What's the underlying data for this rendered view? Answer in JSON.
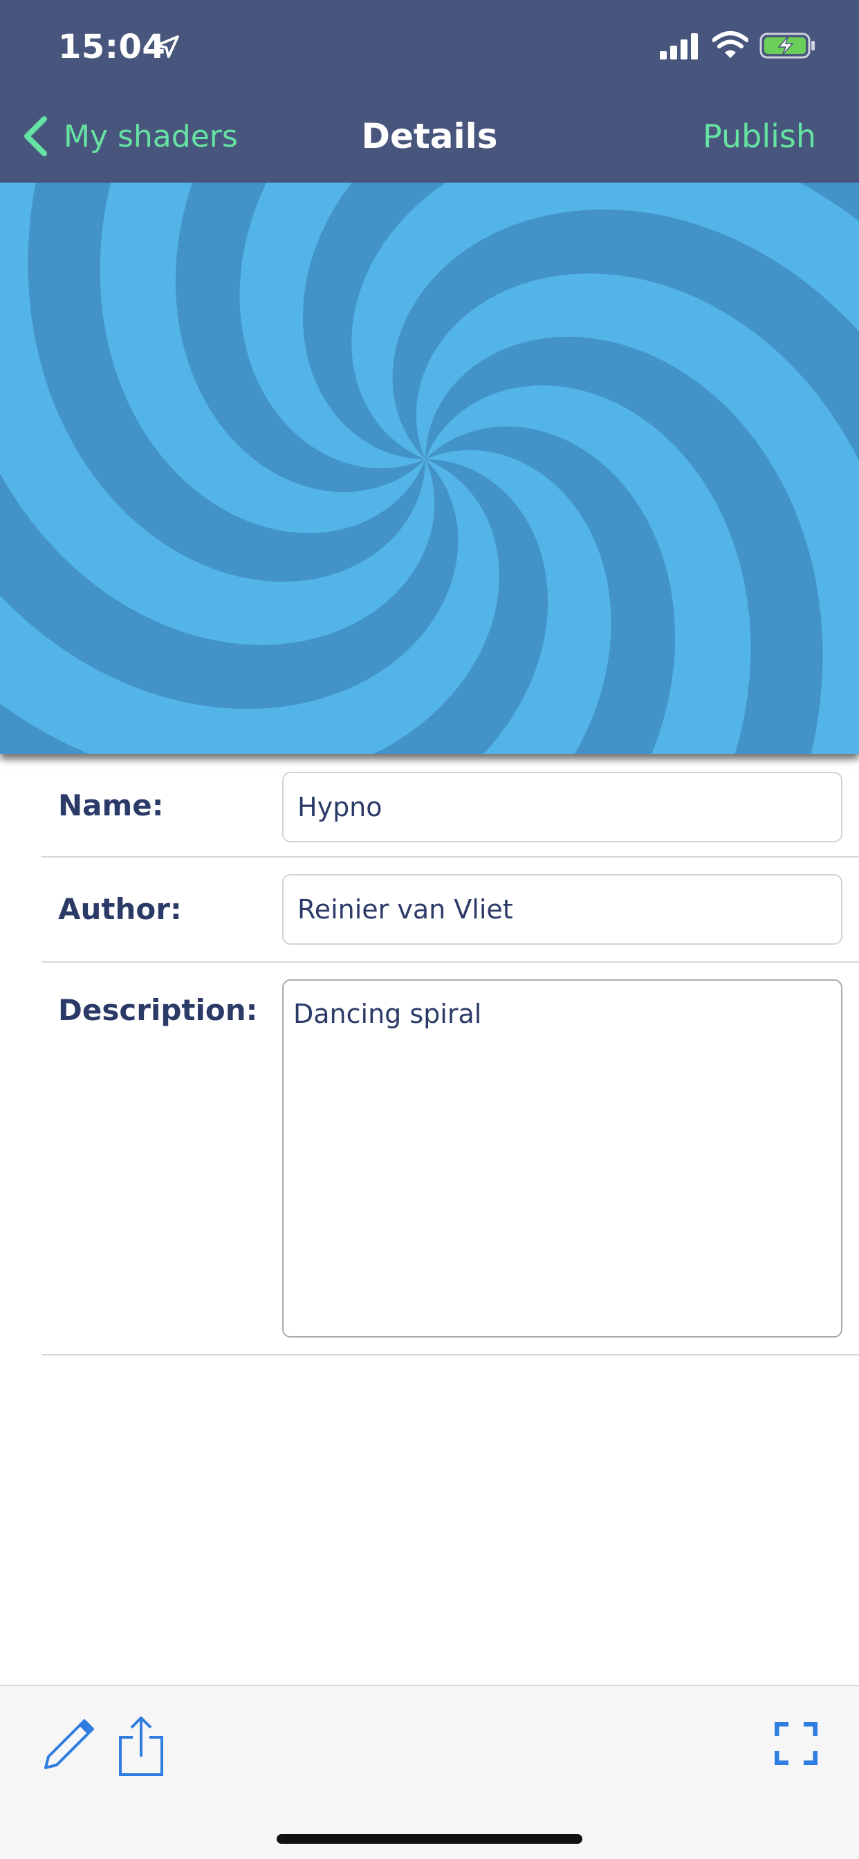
{
  "status_bar": {
    "time": "15:04",
    "icons": [
      "location-arrow-icon",
      "cellular-signal-icon",
      "wifi-icon",
      "battery-charging-icon"
    ]
  },
  "nav": {
    "back_label": "My shaders",
    "title": "Details",
    "publish_label": "Publish"
  },
  "preview": {
    "description": "swirl shader preview",
    "colors": {
      "light": "#53b4e7",
      "dark": "#4493c8"
    }
  },
  "form": {
    "name_label": "Name:",
    "name_value": "Hypno",
    "author_label": "Author:",
    "author_value": "Reinier van Vliet",
    "description_label": "Description:",
    "description_value": "Dancing spiral"
  },
  "toolbar": {
    "icons": [
      "pencil-icon",
      "share-icon",
      "fullscreen-icon"
    ]
  },
  "colors": {
    "header_bg": "#48567d",
    "accent_green": "#66e3a2",
    "label_text": "#2b3a67",
    "toolbar_icon": "#2f7de0"
  }
}
